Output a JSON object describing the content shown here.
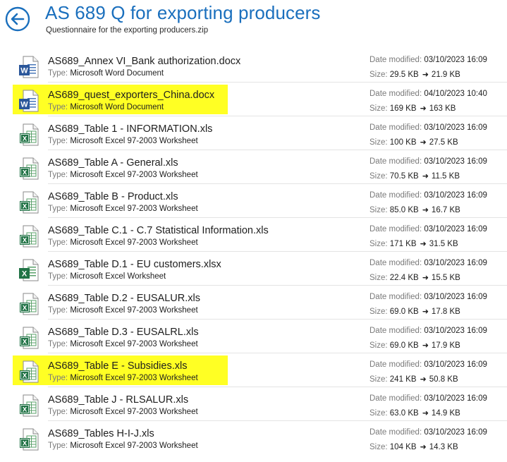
{
  "header": {
    "title": "AS 689 Q for exporting producers",
    "subtitle": "Questionnaire for the exporting producers.zip"
  },
  "labels": {
    "type": "Type:",
    "date_modified": "Date modified:",
    "size": "Size:"
  },
  "colors": {
    "title": "#1a6fbd",
    "highlight": "#ffff24",
    "word": "#2b579a",
    "excel": "#217346"
  },
  "files": [
    {
      "name": "AS689_Annex VI_Bank authorization.docx",
      "type": "Microsoft Word Document",
      "date": "03/10/2023 16:09",
      "size_from": "29.5 KB",
      "size_to": "21.9 KB",
      "icon": "word-icon",
      "highlighted": false
    },
    {
      "name": "AS689_quest_exporters_China.docx",
      "type": "Microsoft Word Document",
      "date": "04/10/2023 10:40",
      "size_from": "169 KB",
      "size_to": "163 KB",
      "icon": "word-icon",
      "highlighted": true
    },
    {
      "name": "AS689_Table 1 - INFORMATION.xls",
      "type": "Microsoft Excel 97-2003 Worksheet",
      "date": "03/10/2023 16:09",
      "size_from": "100 KB",
      "size_to": "27.5 KB",
      "icon": "excel-97-icon",
      "highlighted": false
    },
    {
      "name": "AS689_Table A - General.xls",
      "type": "Microsoft Excel 97-2003 Worksheet",
      "date": "03/10/2023 16:09",
      "size_from": "70.5 KB",
      "size_to": "11.5 KB",
      "icon": "excel-97-icon",
      "highlighted": false
    },
    {
      "name": "AS689_Table B - Product.xls",
      "type": "Microsoft Excel 97-2003 Worksheet",
      "date": "03/10/2023 16:09",
      "size_from": "85.0 KB",
      "size_to": "16.7 KB",
      "icon": "excel-97-icon",
      "highlighted": false
    },
    {
      "name": "AS689_Table C.1 - C.7 Statistical  Information.xls",
      "type": "Microsoft Excel 97-2003 Worksheet",
      "date": "03/10/2023 16:09",
      "size_from": "171 KB",
      "size_to": "31.5 KB",
      "icon": "excel-97-icon",
      "highlighted": false
    },
    {
      "name": "AS689_Table D.1 - EU customers.xlsx",
      "type": "Microsoft Excel Worksheet",
      "date": "03/10/2023 16:09",
      "size_from": "22.4 KB",
      "size_to": "15.5 KB",
      "icon": "excel-icon",
      "highlighted": false
    },
    {
      "name": "AS689_Table D.2 - EUSALUR.xls",
      "type": "Microsoft Excel 97-2003 Worksheet",
      "date": "03/10/2023 16:09",
      "size_from": "69.0 KB",
      "size_to": "17.8 KB",
      "icon": "excel-97-icon",
      "highlighted": false
    },
    {
      "name": "AS689_Table D.3 - EUSALRL.xls",
      "type": "Microsoft Excel 97-2003 Worksheet",
      "date": "03/10/2023 16:09",
      "size_from": "69.0 KB",
      "size_to": "17.9 KB",
      "icon": "excel-97-icon",
      "highlighted": false
    },
    {
      "name": "AS689_Table E - Subsidies.xls",
      "type": "Microsoft Excel 97-2003 Worksheet",
      "date": "03/10/2023 16:09",
      "size_from": "241 KB",
      "size_to": "50.8 KB",
      "icon": "excel-97-icon",
      "highlighted": true
    },
    {
      "name": "AS689_Table J - RLSALUR.xls",
      "type": "Microsoft Excel 97-2003 Worksheet",
      "date": "03/10/2023 16:09",
      "size_from": "63.0 KB",
      "size_to": "14.9 KB",
      "icon": "excel-97-icon",
      "highlighted": false
    },
    {
      "name": "AS689_Tables H-I-J.xls",
      "type": "Microsoft Excel 97-2003 Worksheet",
      "date": "03/10/2023 16:09",
      "size_from": "104 KB",
      "size_to": "14.3 KB",
      "icon": "excel-97-icon",
      "highlighted": false
    }
  ]
}
